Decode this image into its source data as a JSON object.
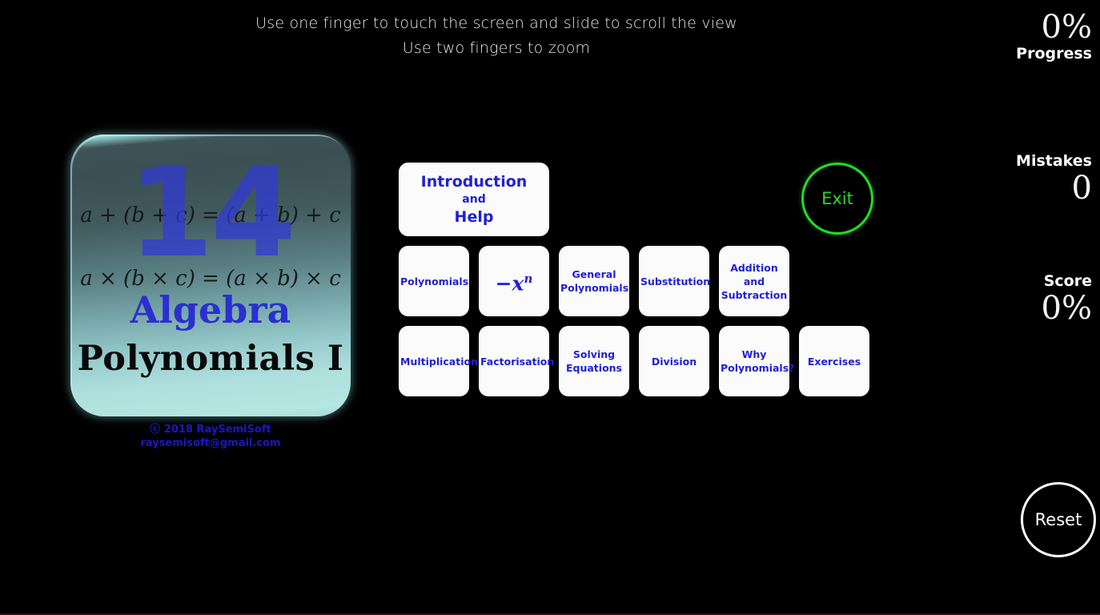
{
  "instructions": {
    "line1": "Use one finger to touch the screen and slide to scroll the view",
    "line2": "Use two fingers to zoom"
  },
  "stats": {
    "progress": {
      "label": "Progress",
      "value": "0%"
    },
    "mistakes": {
      "label": "Mistakes",
      "value": "0"
    },
    "score": {
      "label": "Score",
      "value": "0%"
    }
  },
  "cover": {
    "number": "14",
    "formula1": "a + (b + c) = (a + b) + c",
    "formula2": "a × (b × c) = (a × b) × c",
    "subject": "Algebra",
    "title": "Polynomials I",
    "copyright_line1": "ⓒ 2018 RaySemiSoft",
    "copyright_line2": "raysemisoft@gmail.com"
  },
  "menu": {
    "intro": {
      "line1": "Introduction",
      "line2": "and",
      "line3": "Help"
    },
    "row2": [
      {
        "name": "polynomials",
        "lines": [
          "Polynomials"
        ]
      },
      {
        "name": "negative-x-power-n",
        "lines": [
          "−x"
        ],
        "sup": "n",
        "math": true
      },
      {
        "name": "general-polynomials",
        "lines": [
          "General",
          "Polynomials"
        ]
      },
      {
        "name": "substitution",
        "lines": [
          "Substitution"
        ]
      },
      {
        "name": "addition-subtraction",
        "lines": [
          "Addition",
          "and",
          "Subtraction"
        ]
      }
    ],
    "row3": [
      {
        "name": "multiplication",
        "lines": [
          "Multiplication"
        ]
      },
      {
        "name": "factorisation",
        "lines": [
          "Factorisation"
        ]
      },
      {
        "name": "solving-equations",
        "lines": [
          "Solving",
          "Equations"
        ]
      },
      {
        "name": "division",
        "lines": [
          "Division"
        ]
      },
      {
        "name": "why-polynomials",
        "lines": [
          "Why",
          "Polynomials?"
        ]
      },
      {
        "name": "exercises",
        "lines": [
          "Exercises"
        ]
      }
    ]
  },
  "controls": {
    "exit_label": "Exit",
    "reset_label": "Reset"
  },
  "colors": {
    "background": "#000000",
    "tile_text": "#1f20d8",
    "exit_green": "#22dd22",
    "reset_white": "#ffffff",
    "stat_text": "#f2f2f2"
  }
}
